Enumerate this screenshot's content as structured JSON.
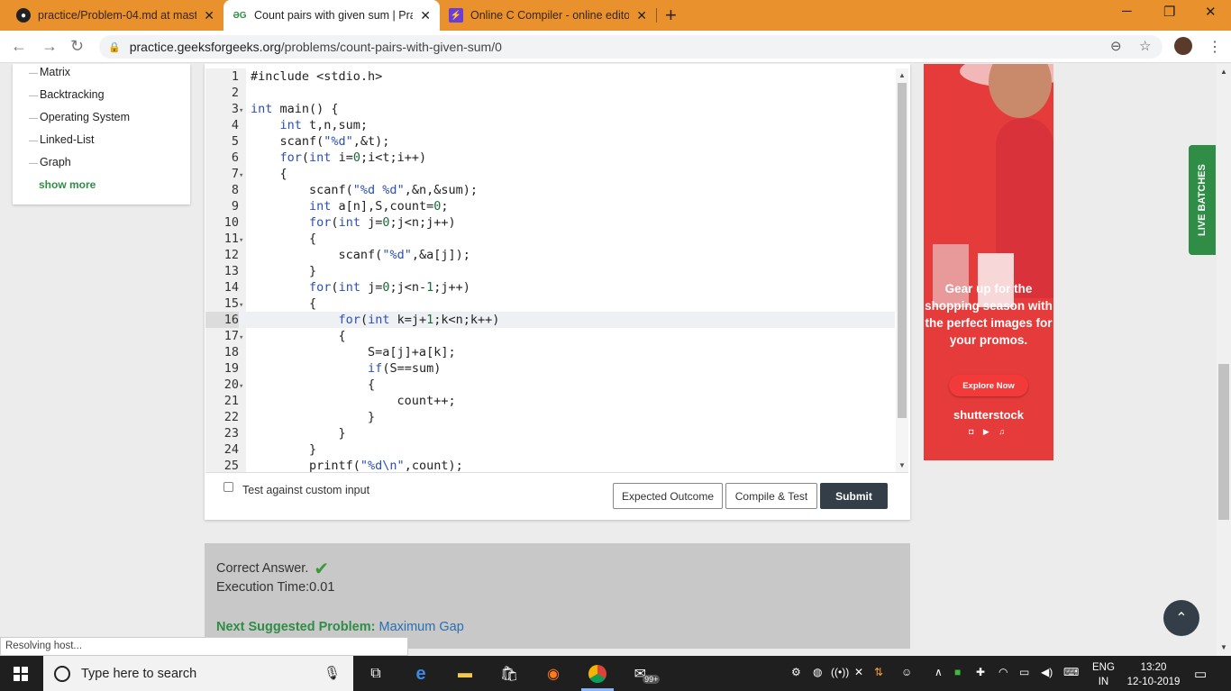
{
  "browser": {
    "tabs": [
      {
        "title": "practice/Problem-04.md at maste",
        "favicon": "github-icon"
      },
      {
        "title": "Count pairs with given sum | Prac",
        "favicon": "gfg-icon"
      },
      {
        "title": "Online C Compiler - online editor",
        "favicon": "onlinegdb-icon"
      }
    ],
    "url_host": "practice.geeksforgeeks.org",
    "url_path": "/problems/count-pairs-with-given-sum/0"
  },
  "sidebar": {
    "items": [
      "Matrix",
      "Backtracking",
      "Operating System",
      "Linked-List",
      "Graph"
    ],
    "show_more": "show more"
  },
  "editor": {
    "active_line": 16,
    "lines": [
      "#include <stdio.h>",
      "",
      "int main() {",
      "    int t,n,sum;",
      "    scanf(\"%d\",&t);",
      "    for(int i=0;i<t;i++)",
      "    {",
      "        scanf(\"%d %d\",&n,&sum);",
      "        int a[n],S,count=0;",
      "        for(int j=0;j<n;j++)",
      "        {",
      "            scanf(\"%d\",&a[j]);",
      "        }",
      "        for(int j=0;j<n-1;j++)",
      "        {",
      "            for(int k=j+1;k<n;k++)",
      "            {",
      "                S=a[j]+a[k];",
      "                if(S==sum)",
      "                {",
      "                    count++;",
      "                }",
      "            }",
      "        }",
      "        printf(\"%d\\n\",count);"
    ],
    "fold_lines": [
      3,
      7,
      11,
      15,
      17,
      20
    ]
  },
  "controls": {
    "custom_input_label": "Test against custom input",
    "expected_outcome": "Expected Outcome",
    "compile_test": "Compile & Test",
    "submit": "Submit"
  },
  "result": {
    "status": "Correct Answer.",
    "exec_time": "Execution Time:0.01",
    "next_label": "Next Suggested Problem:",
    "next_link": "Maximum Gap"
  },
  "ad": {
    "text": "Gear up for the shopping season with the perfect images for your promos.",
    "cta": "Explore Now",
    "brand": "shutterstock"
  },
  "live_batches": "LIVE BATCHES",
  "status_bar": "Resolving host...",
  "taskbar": {
    "search_placeholder": "Type here to search",
    "lang": "ENG",
    "region": "IN",
    "time": "13:20",
    "date": "12-10-2019",
    "badge": "99+"
  }
}
